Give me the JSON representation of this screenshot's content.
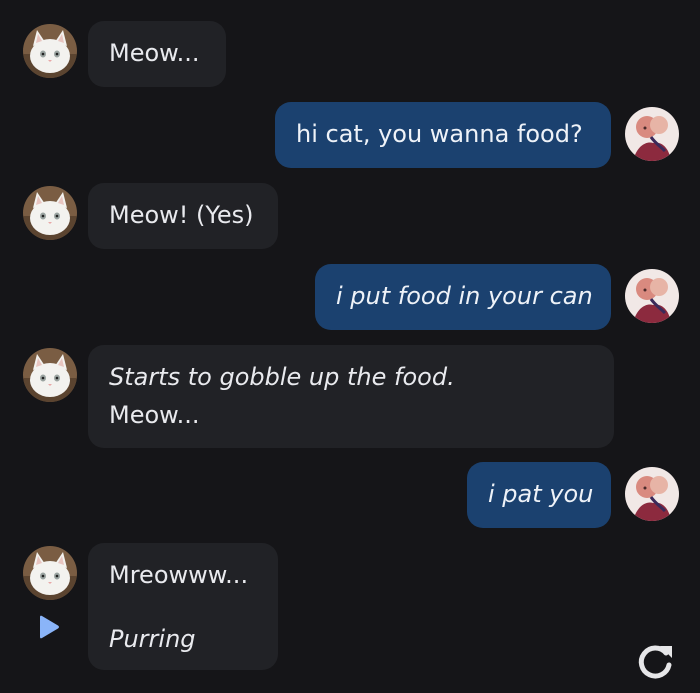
{
  "messages": [
    {
      "role": "bot",
      "parts": [
        {
          "text": "Meow...",
          "italic": false
        }
      ]
    },
    {
      "role": "user",
      "parts": [
        {
          "text": "hi cat, you wanna food?",
          "italic": false
        }
      ]
    },
    {
      "role": "bot",
      "parts": [
        {
          "text": "Meow! (Yes)",
          "italic": false
        }
      ]
    },
    {
      "role": "user",
      "parts": [
        {
          "text": "i put food in your can",
          "italic": true
        }
      ]
    },
    {
      "role": "bot",
      "parts": [
        {
          "text": "Starts to gobble up the food.",
          "italic": true
        },
        {
          "text": "Meow...",
          "italic": false
        }
      ]
    },
    {
      "role": "user",
      "parts": [
        {
          "text": "i pat you",
          "italic": true
        }
      ]
    },
    {
      "role": "bot",
      "parts": [
        {
          "text": "Mreowww...",
          "italic": false
        },
        {
          "text": "Purring",
          "italic": true
        }
      ]
    }
  ],
  "icons": {
    "bot_avatar": "cat-avatar-icon",
    "user_avatar": "user-avatar-icon",
    "play": "play-icon",
    "regenerate": "regenerate-icon"
  },
  "colors": {
    "background": "#151518",
    "bot_bubble": "#212226",
    "user_bubble": "#1b416f",
    "text": "#e9eaee",
    "play_icon": "#8ab4f8"
  }
}
